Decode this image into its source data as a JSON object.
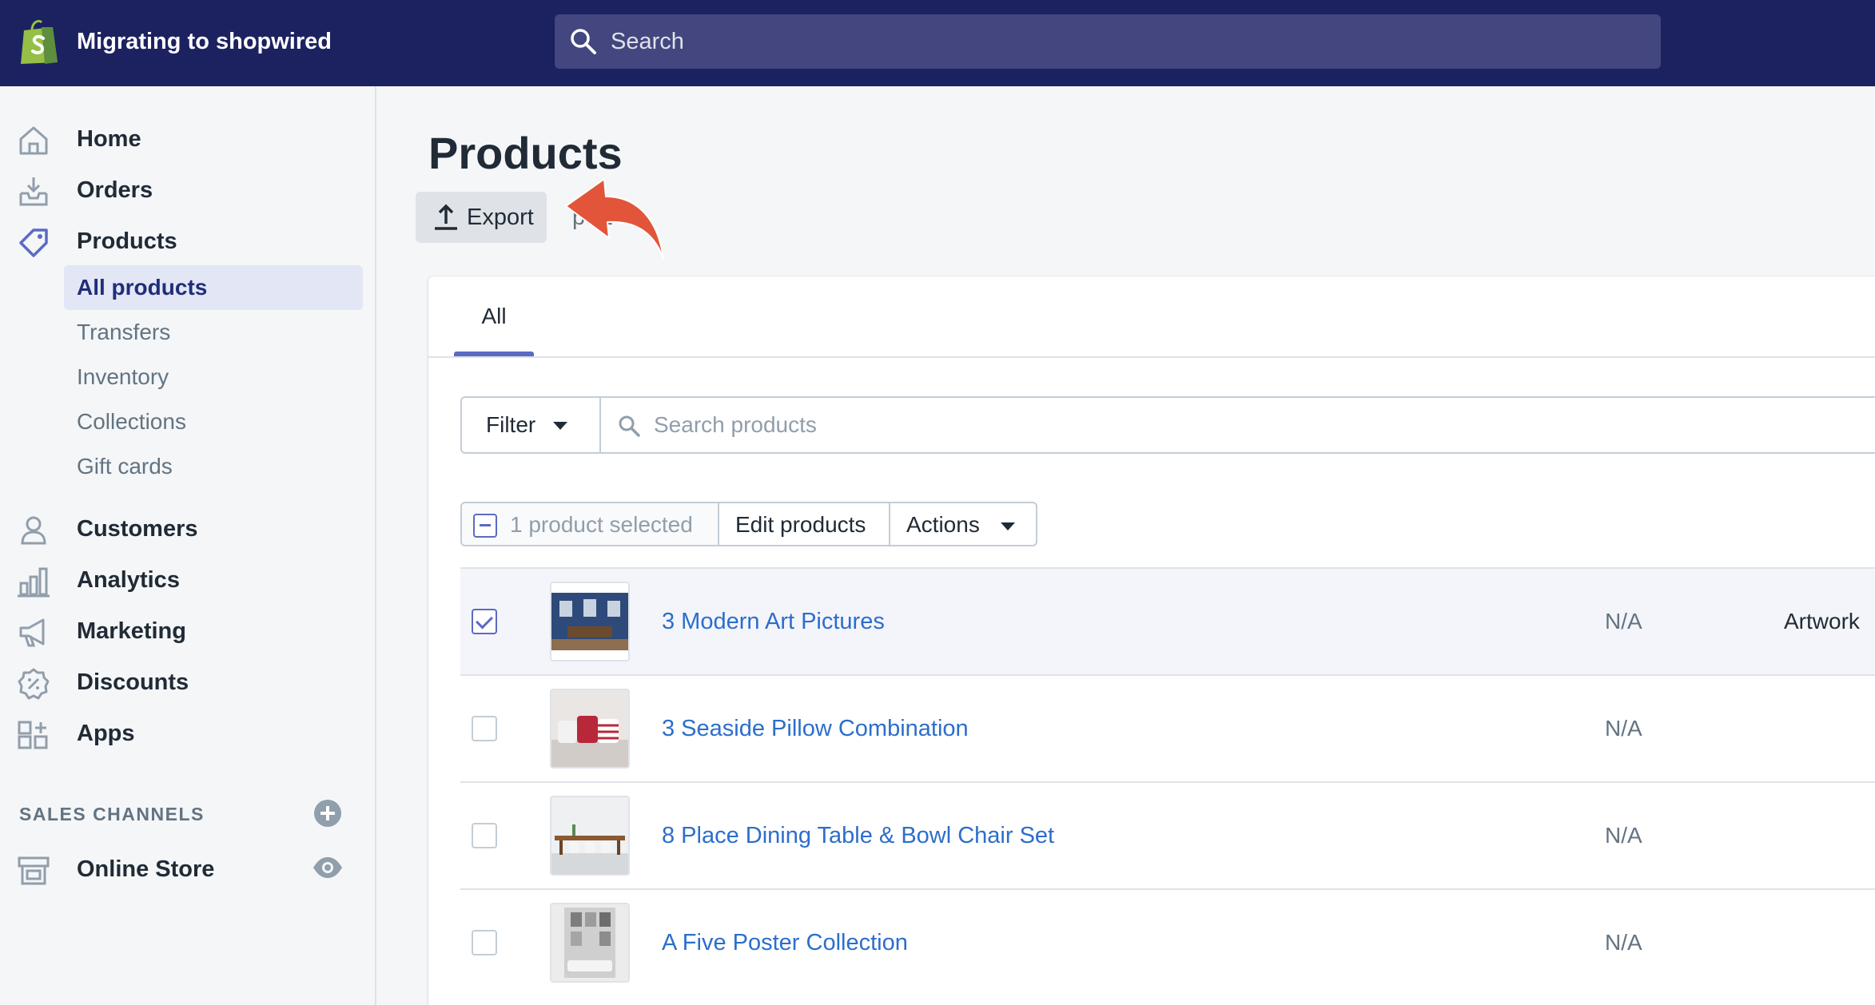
{
  "topbar": {
    "store_name": "Migrating to shopwired",
    "search_placeholder": "Search",
    "logo_icon": "shopify-bag-icon"
  },
  "sidebar": {
    "items": [
      {
        "label": "Home",
        "icon": "home-icon"
      },
      {
        "label": "Orders",
        "icon": "orders-inbox-icon"
      },
      {
        "label": "Products",
        "icon": "tag-icon",
        "active": true
      },
      {
        "label": "Customers",
        "icon": "person-icon"
      },
      {
        "label": "Analytics",
        "icon": "bar-chart-icon"
      },
      {
        "label": "Marketing",
        "icon": "megaphone-icon"
      },
      {
        "label": "Discounts",
        "icon": "discount-badge-icon"
      },
      {
        "label": "Apps",
        "icon": "apps-grid-icon"
      }
    ],
    "product_subitems": [
      {
        "label": "All products",
        "selected": true
      },
      {
        "label": "Transfers"
      },
      {
        "label": "Inventory"
      },
      {
        "label": "Collections"
      },
      {
        "label": "Gift cards"
      }
    ],
    "sales_channels_heading": "SALES CHANNELS",
    "channels": [
      {
        "label": "Online Store",
        "icon": "store-icon"
      }
    ]
  },
  "main": {
    "title": "Products",
    "export_label": "Export",
    "import_label": "port",
    "tabs": [
      {
        "label": "All",
        "selected": true
      }
    ],
    "filter_label": "Filter",
    "search_placeholder": "Search products",
    "bulk": {
      "selected_label": "1 product selected",
      "edit_label": "Edit products",
      "actions_label": "Actions"
    },
    "products": [
      {
        "name": "3 Modern Art Pictures",
        "inventory": "N/A",
        "type": "Artwork",
        "checked": true
      },
      {
        "name": "3 Seaside Pillow Combination",
        "inventory": "N/A",
        "type": "",
        "checked": false
      },
      {
        "name": "8 Place Dining Table & Bowl Chair Set",
        "inventory": "N/A",
        "type": "",
        "checked": false
      },
      {
        "name": "A Five Poster Collection",
        "inventory": "N/A",
        "type": "",
        "checked": false
      }
    ]
  },
  "colors": {
    "topbar": "#1c2260",
    "accent": "#5c6ac4",
    "link": "#2c6ecb",
    "annotation_arrow": "#e2553a"
  }
}
